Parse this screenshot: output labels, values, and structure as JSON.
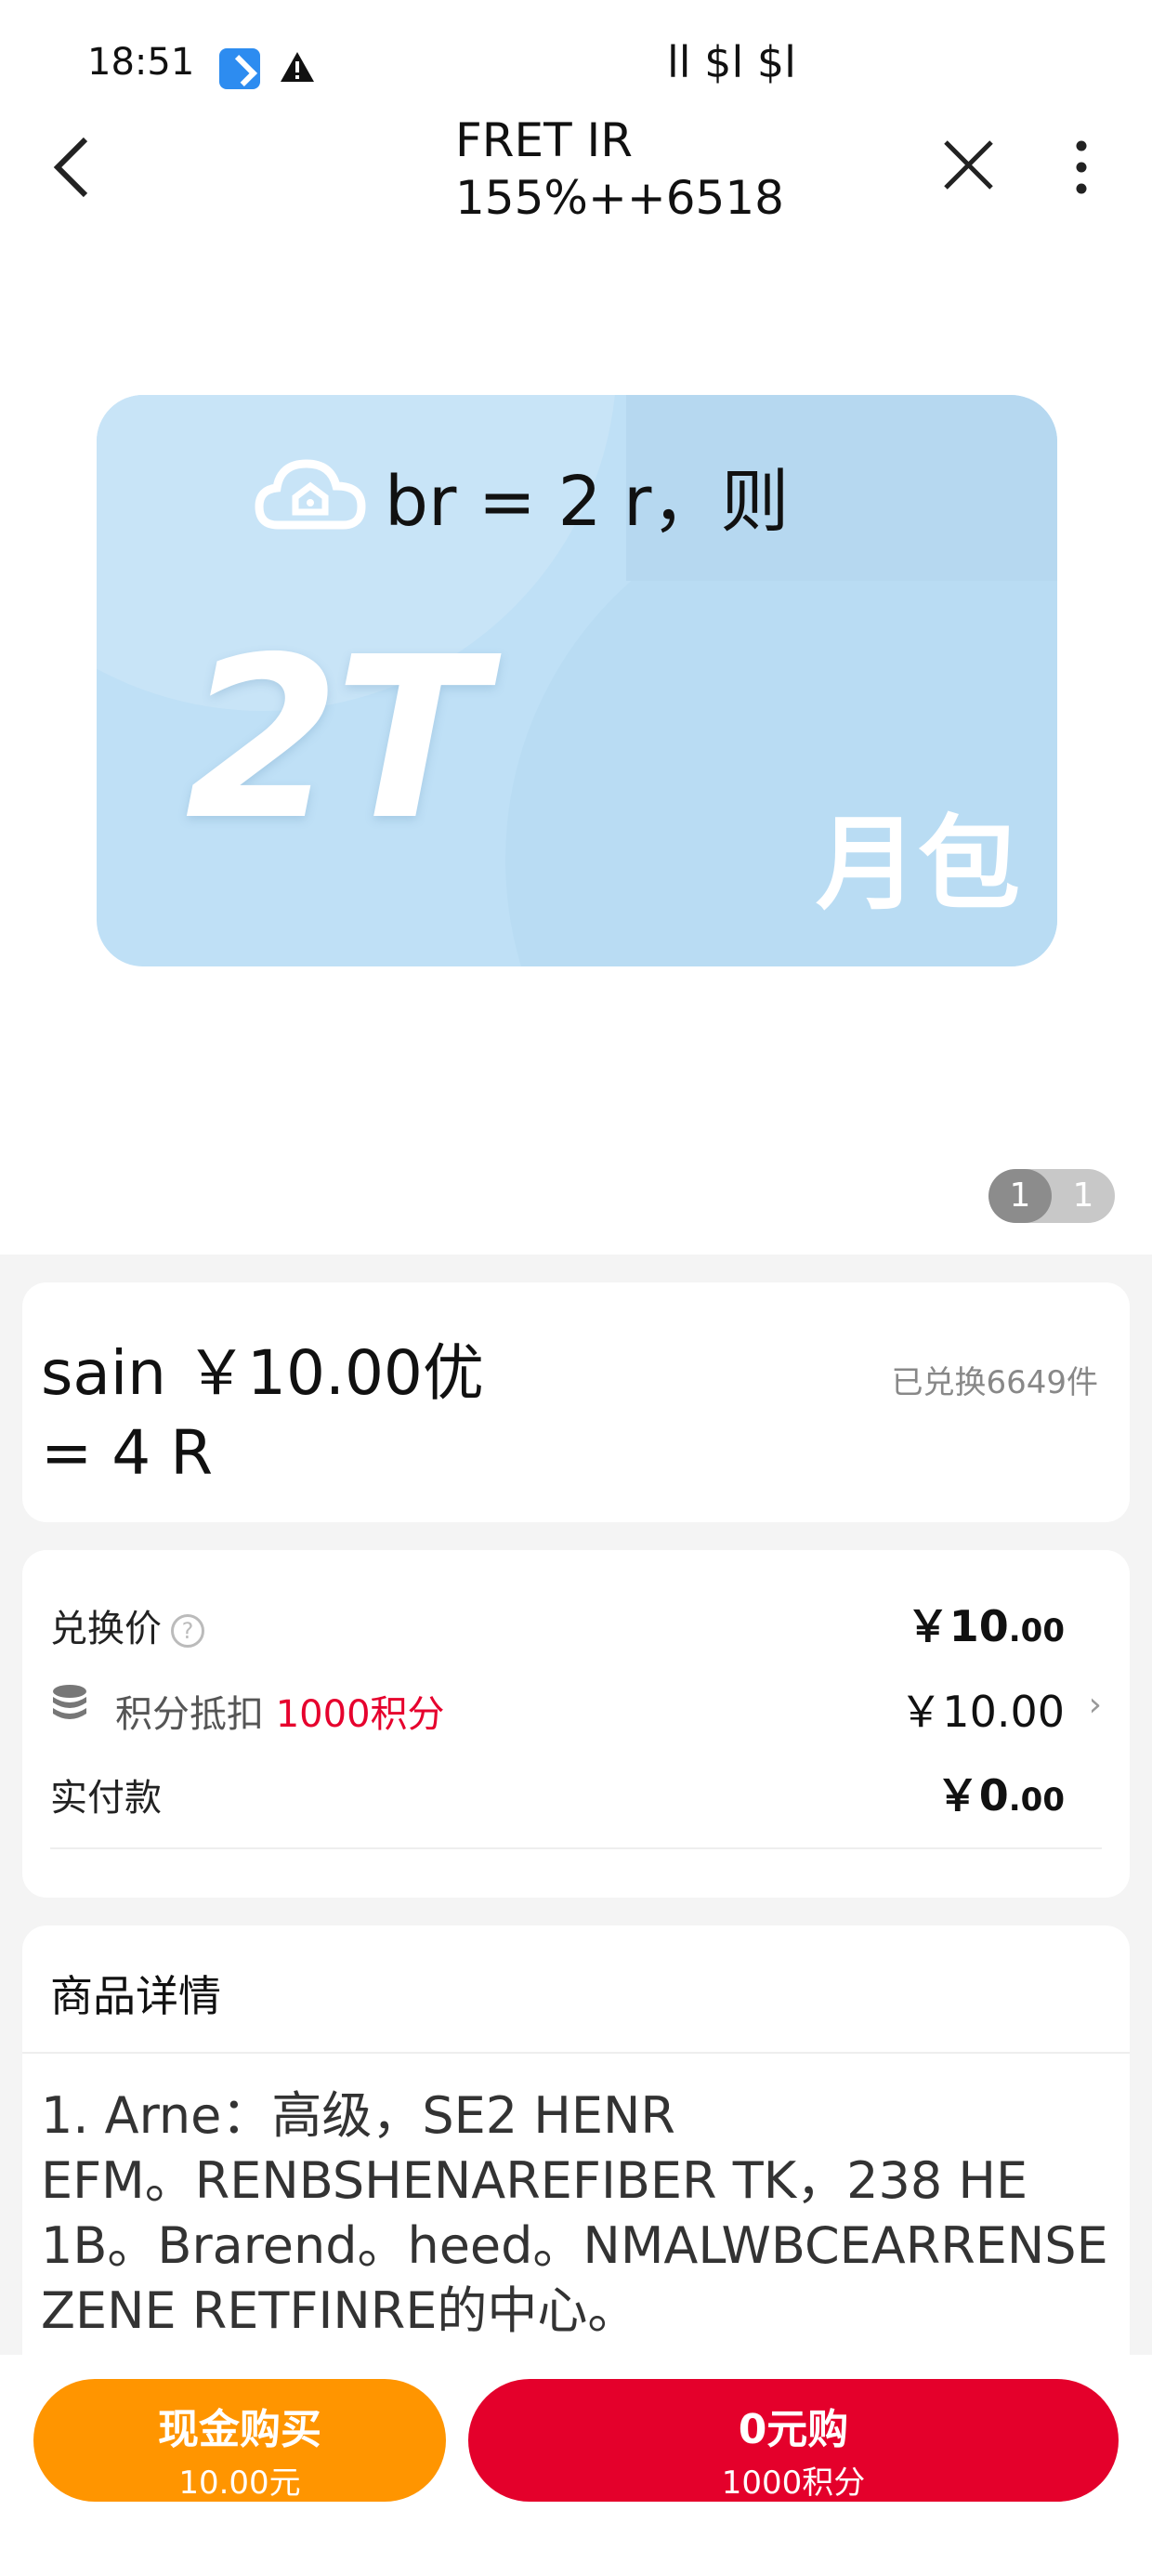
{
  "status_bar": {
    "time": "18:51",
    "signal": "ll $l $l",
    "icons": [
      "app-notification-icon",
      "warning-icon"
    ]
  },
  "nav": {
    "title_line1": "FRET IR",
    "title_line2": "155%++6518"
  },
  "product_image": {
    "caption": "br = 2 r，则",
    "size": "2T",
    "tag": "月包",
    "pager_current": "1",
    "pager_total": "1"
  },
  "product": {
    "name_line1": "sain ￥10.00优",
    "name_line2": "= 4 R",
    "sold": "已兑换6649件"
  },
  "pricing": {
    "exchange_label": "兑换价",
    "exchange_value_main": "￥10",
    "exchange_value_dec": ".00",
    "points_label_prefix": "积分抵扣 ",
    "points_label_highlight": "1000积分",
    "points_value": "￥10.00",
    "paid_label": "实付款",
    "paid_value_main": "￥0",
    "paid_value_dec": ".00"
  },
  "details": {
    "heading": "商品详情",
    "text": "1. Arne：高级，SE2 HENR\nEFM。RENBSHENAREFIBER TK，238 HE\n1B。Brarend。heed。NMALWBCEARRENSE\nZENE RETFINRE的中心。"
  },
  "actions": {
    "cash_main": "现金购买",
    "cash_sub": "10.00元",
    "points_main": "0元购",
    "points_sub": "1000积分"
  },
  "colors": {
    "accent_red": "#e4002b",
    "accent_orange": "#ff9500",
    "card_blue": "#bfe0f6"
  }
}
